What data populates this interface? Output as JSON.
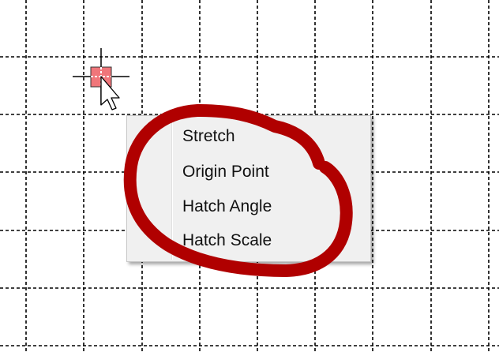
{
  "context_menu": {
    "items": [
      {
        "label": "Stretch"
      },
      {
        "label": "Origin Point"
      },
      {
        "label": "Hatch Angle"
      },
      {
        "label": "Hatch Scale"
      }
    ]
  },
  "colors": {
    "grid": "#000000",
    "grip": "#f0767a",
    "annotation": "#b00000",
    "menu_background": "#f0f0f0"
  },
  "icons": {
    "crosshair": "crosshair-icon",
    "grip": "grip-icon",
    "cursor": "arrow-cursor-icon"
  }
}
